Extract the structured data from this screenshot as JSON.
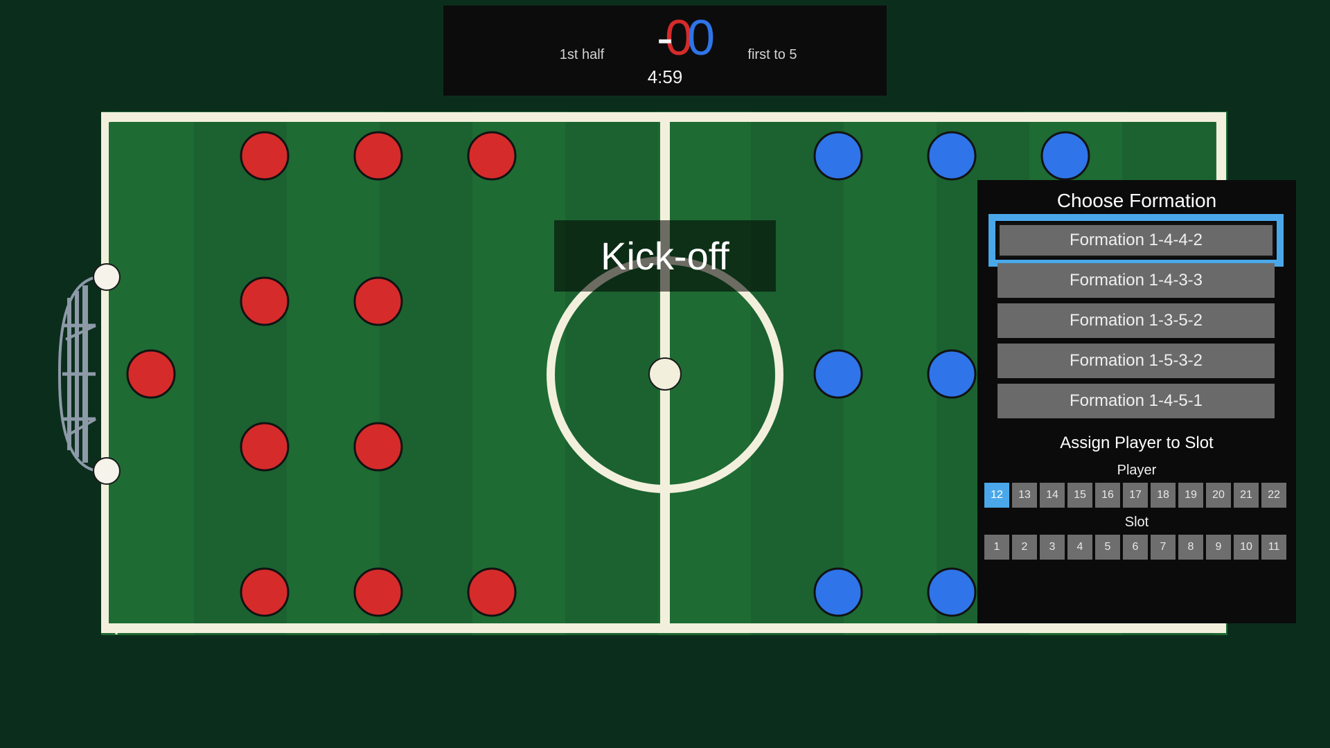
{
  "scoreboard": {
    "half": "1st half",
    "home_score": "0",
    "separator": "-",
    "away_score": "0",
    "rule": "first to 5",
    "clock": "4:59"
  },
  "banner": {
    "text": "Kick-off"
  },
  "colors": {
    "home": "#d62b2b",
    "away": "#2f74e8",
    "pitch": "#1e6b33",
    "lines": "#f2f0dc",
    "highlight": "#4aa8ea"
  },
  "formation_panel": {
    "title": "Choose Formation",
    "options": [
      "Formation 1-4-4-2",
      "Formation 1-4-3-3",
      "Formation 1-3-5-2",
      "Formation 1-5-3-2",
      "Formation 1-4-5-1"
    ],
    "selected_option": "Formation 1-4-4-2",
    "assign_title": "Assign Player to Slot",
    "player_label": "Player",
    "players": [
      "12",
      "13",
      "14",
      "15",
      "16",
      "17",
      "18",
      "19",
      "20",
      "21",
      "22"
    ],
    "selected_player": "12",
    "slot_label": "Slot",
    "slots": [
      "1",
      "2",
      "3",
      "4",
      "5",
      "6",
      "7",
      "8",
      "9",
      "10",
      "11"
    ]
  }
}
